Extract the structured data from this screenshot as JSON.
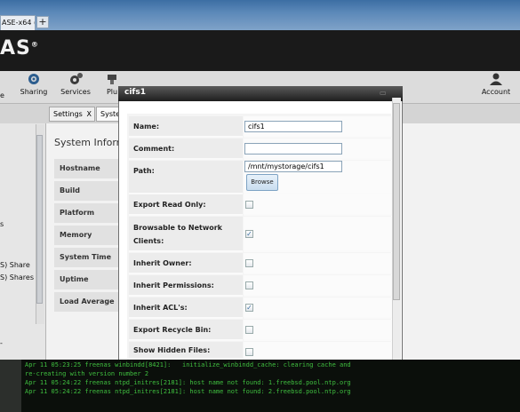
{
  "browser": {
    "tab_title": "ASE-x64 (...",
    "new_tab": "+"
  },
  "app": {
    "logo": "AS",
    "logo_mark": "®"
  },
  "toolbar": {
    "items": [
      {
        "label": "e",
        "icon": "system-icon"
      },
      {
        "label": "Sharing",
        "icon": "sharing-icon"
      },
      {
        "label": "Services",
        "icon": "services-icon"
      },
      {
        "label": "Plu",
        "icon": "plugins-icon"
      },
      {
        "label": "Account",
        "icon": "account-icon"
      }
    ]
  },
  "tabs": [
    {
      "label": "Settings",
      "close": "X"
    },
    {
      "label": "Syste"
    }
  ],
  "left_panel": {
    "items": [
      "s",
      "S) Share",
      "S) Shares"
    ],
    "bottom": "-"
  },
  "main": {
    "title": "System Inform",
    "rows": [
      "Hostname",
      "Build",
      "Platform",
      "Memory",
      "System Time",
      "Uptime",
      "Load Average"
    ]
  },
  "modal": {
    "title": "cifs1",
    "fields": {
      "name": {
        "label": "Name:",
        "value": "cifs1"
      },
      "comment": {
        "label": "Comment:",
        "value": ""
      },
      "path": {
        "label": "Path:",
        "value": "/mnt/mystorage/cifs1",
        "browse": "Browse"
      },
      "export_read_only": {
        "label": "Export Read Only:",
        "checked": false
      },
      "browsable": {
        "label": "Browsable to Network Clients:",
        "checked": true
      },
      "inherit_owner": {
        "label": "Inherit Owner:",
        "checked": false
      },
      "inherit_permissions": {
        "label": "Inherit Permissions:",
        "checked": false
      },
      "inherit_acls": {
        "label": "Inherit ACL's:",
        "checked": true
      },
      "export_recycle_bin": {
        "label": "Export Recycle Bin:",
        "checked": false
      },
      "show_hidden_files": {
        "label": "Show Hidden Files:",
        "checked": false
      }
    }
  },
  "console": {
    "lines": [
      "Apr 11 05:23:25 freenas winbindd[8421]:   initialize_winbindd_cache: clearing cache and",
      "re-creating with version number 2",
      "Apr 11 05:24:22 freenas ntpd_initres[2181]: host name not found: 1.freebsd.pool.ntp.org",
      "Apr 11 05:24:22 freenas ntpd_initres[2181]: host name not found: 2.freebsd.pool.ntp.org"
    ]
  },
  "colors": {
    "accent": "#3a6da0",
    "header": "#1a1a1a",
    "console_text": "#3fbf3f"
  }
}
